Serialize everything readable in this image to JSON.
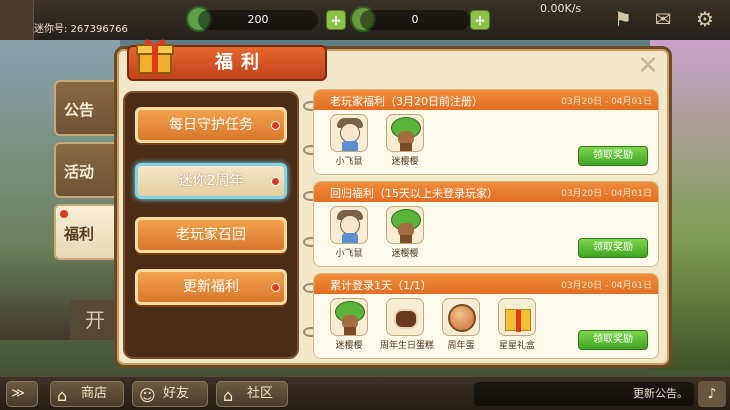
{
  "topbar": {
    "player_name": "",
    "player_id": "迷你号: 267396766",
    "res1_value": "200",
    "res2_value": "0",
    "net_speed": "0.00K/s",
    "plus": "+"
  },
  "side_tabs": [
    {
      "label": "公告"
    },
    {
      "label": "活动"
    },
    {
      "label": "福利"
    }
  ],
  "modal": {
    "title": "福利",
    "close": "✕"
  },
  "menu": [
    {
      "label": "每日守护任务"
    },
    {
      "label": "迷你2周年"
    },
    {
      "label": "老玩家召回"
    },
    {
      "label": "更新福利"
    }
  ],
  "cards": [
    {
      "title": "老玩家福利（3月20日前注册）",
      "date": "03月20日 - 04月01日",
      "items": [
        "小飞鼠",
        "迷樱樱"
      ],
      "button": "领取奖励"
    },
    {
      "title": "回归福利（15天以上未登录玩家）",
      "date": "03月20日 - 04月01日",
      "items": [
        "小飞鼠",
        "迷樱樱"
      ],
      "button": "领取奖励"
    },
    {
      "title": "累计登录1天（1/1）",
      "date": "03月20日 - 04月01日",
      "items": [
        "迷樱樱",
        "周年生日蛋糕",
        "周年蛋",
        "星星礼盒"
      ],
      "button": "领取奖励"
    }
  ],
  "bottombar": {
    "expand": "≫",
    "shop": "商店",
    "friends": "好友",
    "community": "社区",
    "announce": "更新公告。"
  },
  "colors": {
    "title_banner": "#d4521f",
    "menu_button": "#e68a35",
    "claim_button": "#4cb52b",
    "card_header": "#e8792b"
  }
}
